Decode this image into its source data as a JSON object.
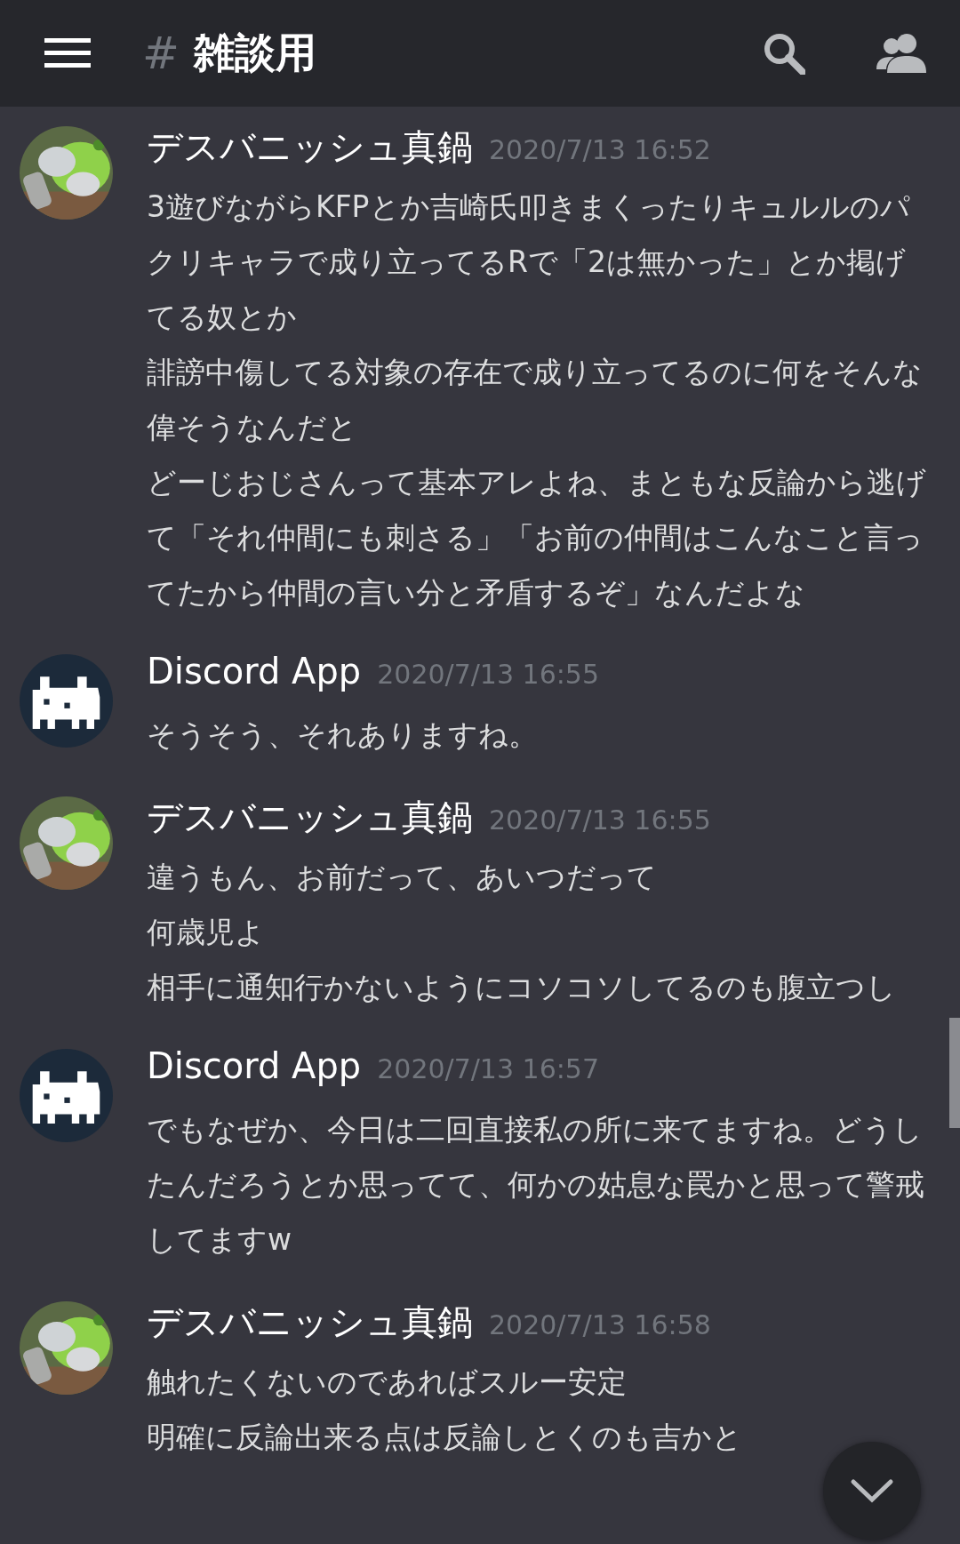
{
  "header": {
    "hash": "#",
    "channel": "雑談用"
  },
  "messages": [
    {
      "author": "デスバニッシュ真鍋",
      "timestamp": "2020/7/13 16:52",
      "lines": [
        "3遊びながらKFPとか吉崎氏叩きまくったりキュルルのパクリキャラで成り立ってるRで「2は無かった」とか掲げてる奴とか",
        "誹謗中傷してる対象の存在で成り立ってるのに何をそんな偉そうなんだと",
        "どーじおじさんって基本アレよね、まともな反論から逃げて「それ仲間にも刺さる」「お前の仲間はこんなこと言ってたから仲間の言い分と矛盾するぞ」なんだよな"
      ]
    },
    {
      "kind": "bot",
      "author": "Discord App",
      "timestamp": "2020/7/13 16:55",
      "lines": [
        "そうそう、それありますね。"
      ]
    },
    {
      "author": "デスバニッシュ真鍋",
      "timestamp": "2020/7/13 16:55",
      "lines": [
        "違うもん、お前だって、あいつだって",
        "何歳児よ",
        "相手に通知行かないようにコソコソしてるのも腹立つし"
      ]
    },
    {
      "kind": "bot",
      "author": "Discord App",
      "timestamp": "2020/7/13 16:57",
      "lines": [
        "でもなぜか、今日は二回直接私の所に来てますね。どうしたんだろうとか思ってて、何かの姑息な罠かと思って警戒してますw"
      ]
    },
    {
      "author": "デスバニッシュ真鍋",
      "timestamp": "2020/7/13 16:58",
      "lines": [
        "触れたくないのであればスルー安定",
        "明確に反論出来る点は反論しとくのも吉かと"
      ]
    }
  ]
}
